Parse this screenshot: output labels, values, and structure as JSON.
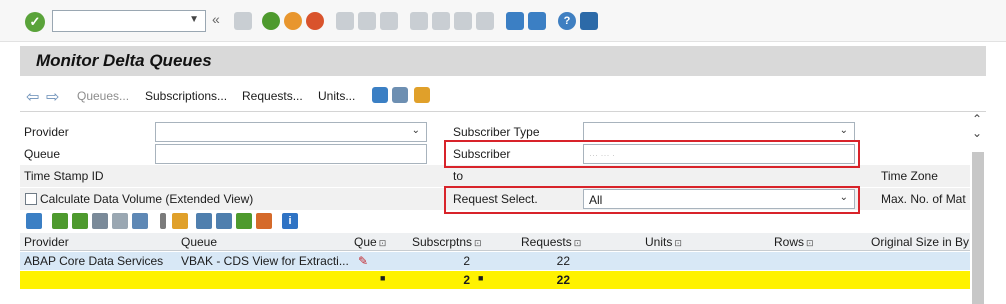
{
  "system_toolbar": {
    "enter_icon": "check-circle-icon",
    "command_field_value": "",
    "collapse_glyph": "«"
  },
  "title": "Monitor Delta Queues",
  "app_toolbar": {
    "queues": "Queues...",
    "subscriptions": "Subscriptions...",
    "requests": "Requests...",
    "units": "Units..."
  },
  "form": {
    "provider_label": "Provider",
    "queue_label": "Queue",
    "timestamp_label": "Time Stamp ID",
    "calc_volume_label": "Calculate Data Volume (Extended View)",
    "subscriber_type_label": "Subscriber Type",
    "subscriber_label": "Subscriber",
    "to_label": "to",
    "request_select_label": "Request Select.",
    "request_select_value": "All",
    "timezone_label": "Time Zone",
    "max_no_label": "Max. No. of Mat",
    "subscriber_blurred": "··· ··· ·"
  },
  "grid": {
    "columns": [
      "Provider",
      "Queue",
      "Que",
      "Subscrptns",
      "Requests",
      "Units",
      "Rows",
      "Original Size in By"
    ],
    "rows": [
      {
        "provider": "ABAP Core Data Services",
        "queue": "VBAK - CDS View for Extracti...",
        "subscriptions": "2",
        "requests": "22",
        "units": "",
        "rows": "",
        "size": ""
      }
    ],
    "totals": {
      "subscriptions": "2",
      "requests": "22"
    }
  },
  "colors": {
    "highlight_box": "#d8232a",
    "total_row": "#fff200",
    "selected_row": "#d8e8f6",
    "title_bar": "#d9d9d9"
  }
}
